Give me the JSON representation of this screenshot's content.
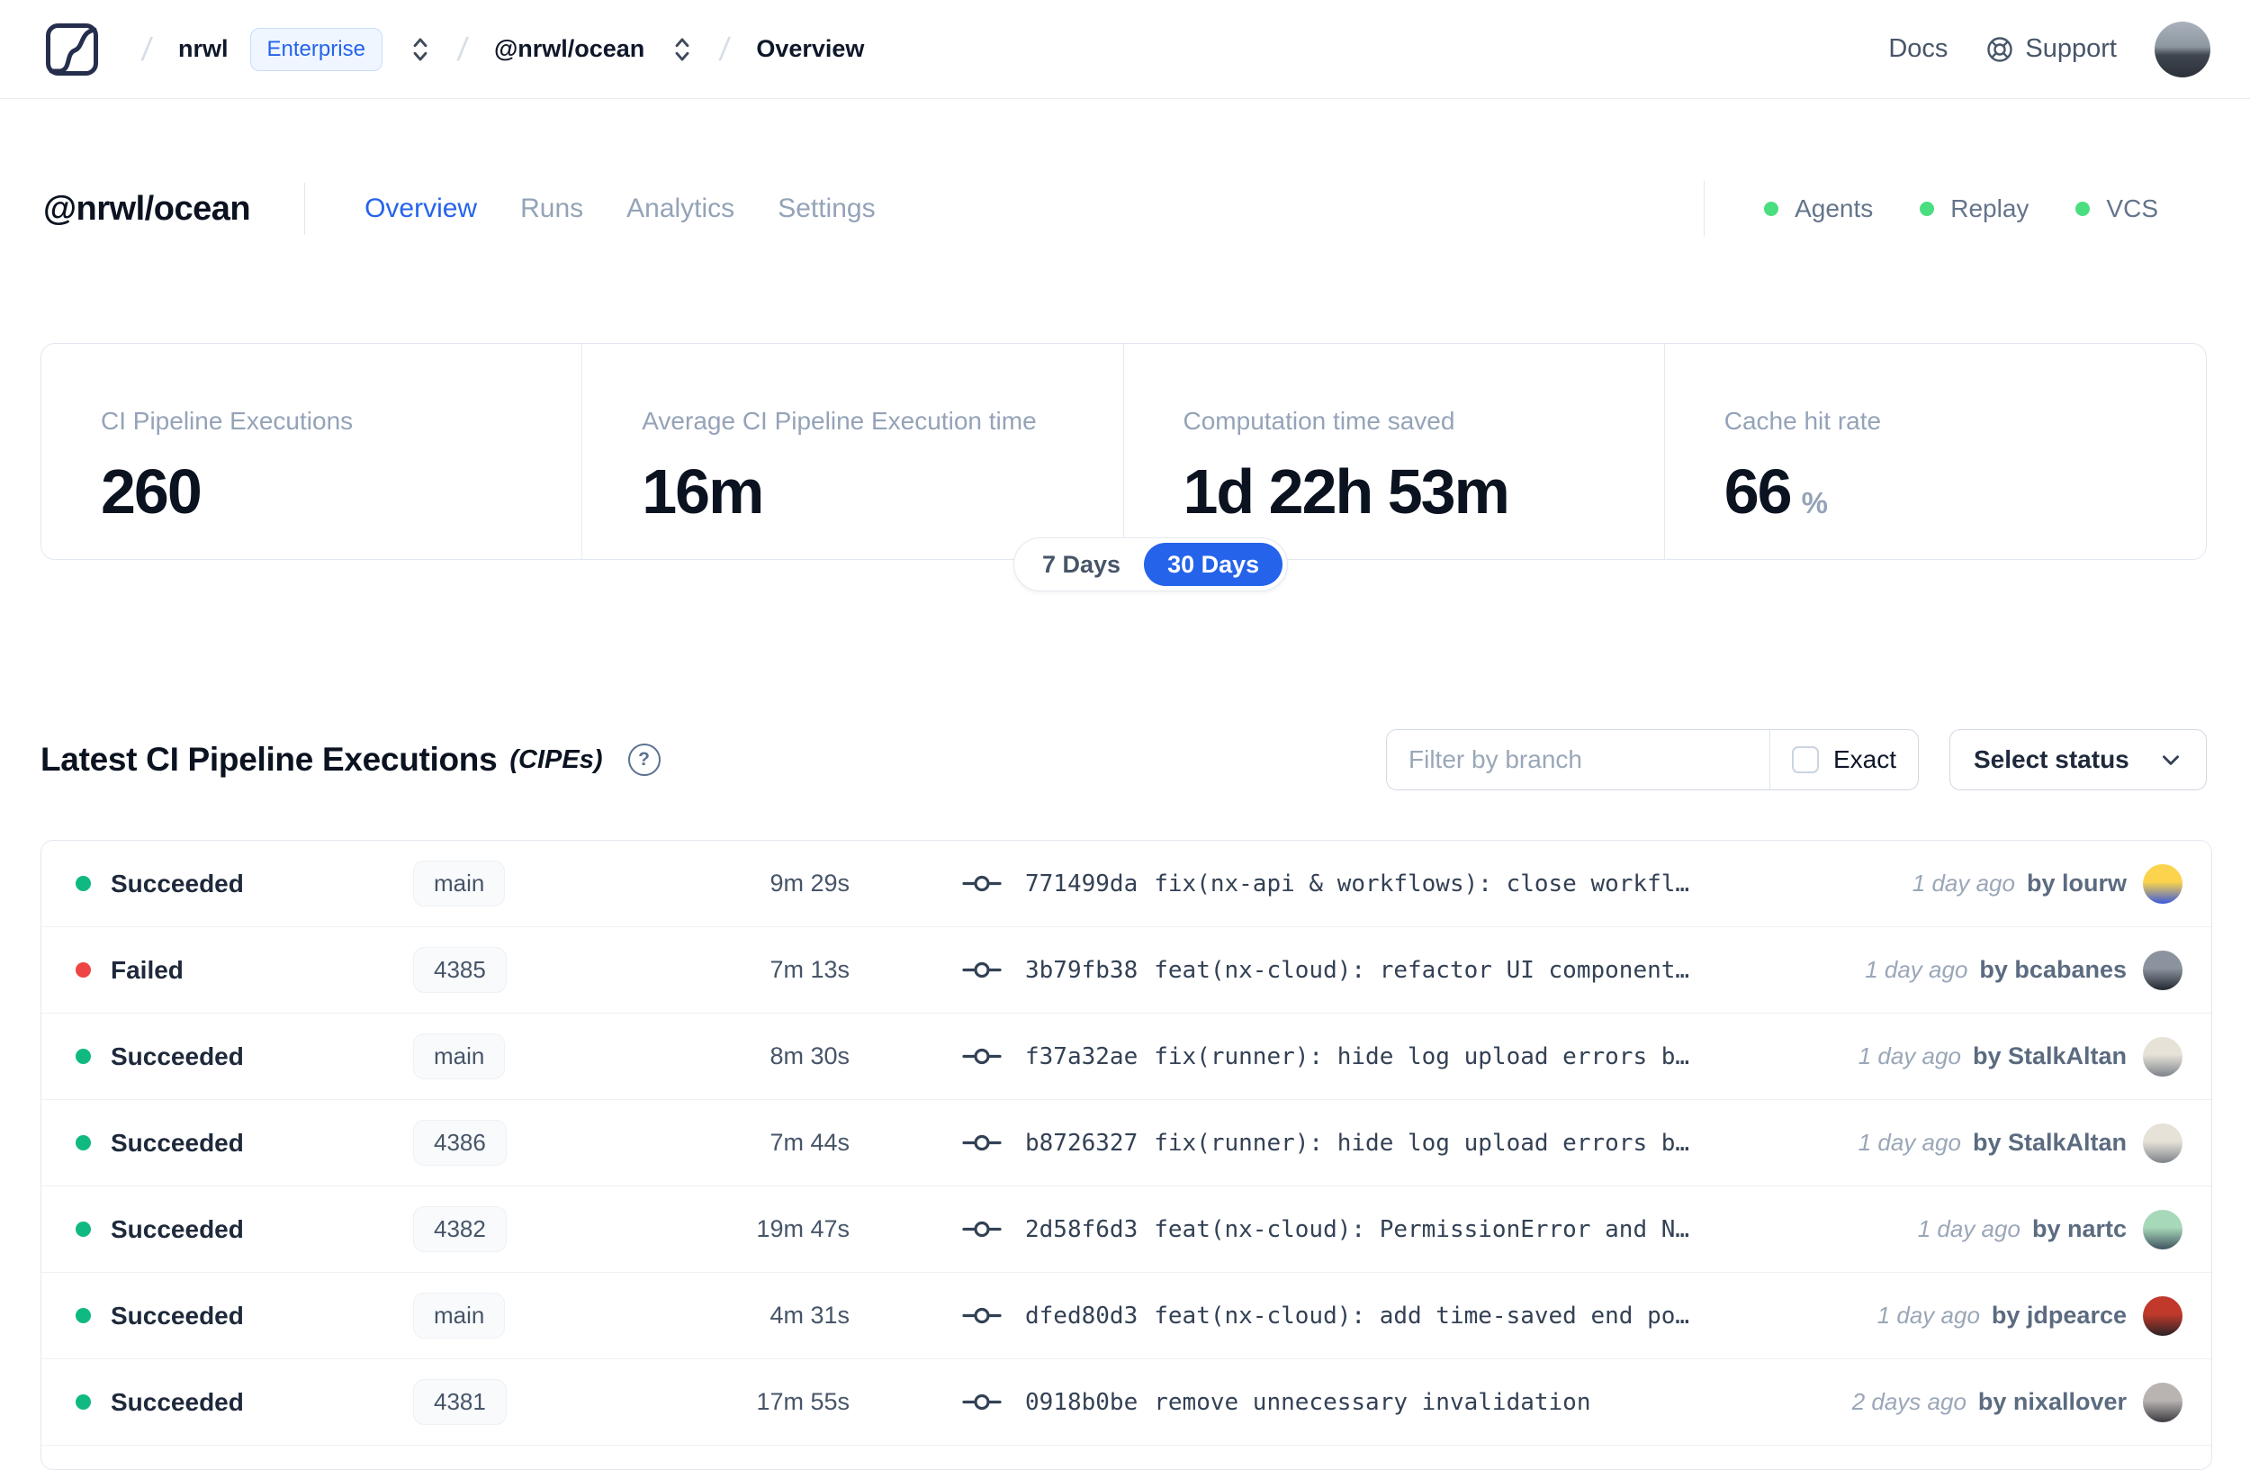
{
  "colors": {
    "accent": "#2563eb",
    "success_dot": "#10b981",
    "failed_dot": "#ef4444",
    "header_status_dot": "#4ade80"
  },
  "navbar": {
    "logo": "nx-logo",
    "breadcrumb": {
      "org": "nrwl",
      "org_badge": "Enterprise",
      "workspace": "@nrwl/ocean",
      "page": "Overview"
    },
    "links": {
      "docs": "Docs",
      "support": "Support"
    }
  },
  "header": {
    "title": "@nrwl/ocean",
    "tabs": [
      {
        "label": "Overview",
        "active": true
      },
      {
        "label": "Runs",
        "active": false
      },
      {
        "label": "Analytics",
        "active": false
      },
      {
        "label": "Settings",
        "active": false
      }
    ],
    "statuses": [
      {
        "label": "Agents"
      },
      {
        "label": "Replay"
      },
      {
        "label": "VCS"
      }
    ]
  },
  "stats": {
    "cards": [
      {
        "label": "CI Pipeline Executions",
        "value": "260",
        "unit": ""
      },
      {
        "label": "Average CI Pipeline Execution time",
        "value": "16m",
        "unit": ""
      },
      {
        "label": "Computation time saved",
        "value": "1d 22h 53m",
        "unit": ""
      },
      {
        "label": "Cache hit rate",
        "value": "66",
        "unit": "%"
      }
    ],
    "range_toggle": {
      "options": [
        "7 Days",
        "30 Days"
      ],
      "selected": "30 Days"
    }
  },
  "cipes": {
    "title": "Latest CI Pipeline Executions",
    "title_suffix": "(CIPEs)",
    "filter_placeholder": "Filter by branch",
    "filter_value": "",
    "exact_label": "Exact",
    "exact_checked": false,
    "status_select_label": "Select status",
    "rows": [
      {
        "status": "Succeeded",
        "branch": "main",
        "duration": "9m 29s",
        "commit": "771499da",
        "message": "fix(nx-api & workflows): close workfl…",
        "time": "1 day ago",
        "author": "by lourw",
        "avatar_colors": [
          "#fcd34d",
          "#3b5bdb"
        ]
      },
      {
        "status": "Failed",
        "branch": "4385",
        "duration": "7m 13s",
        "commit": "3b79fb38",
        "message": "feat(nx-cloud): refactor UI component…",
        "time": "1 day ago",
        "author": "by bcabanes",
        "avatar_colors": [
          "#8a939e",
          "#23282f"
        ]
      },
      {
        "status": "Succeeded",
        "branch": "main",
        "duration": "8m 30s",
        "commit": "f37a32ae",
        "message": "fix(runner): hide log upload errors b…",
        "time": "1 day ago",
        "author": "by StalkAltan",
        "avatar_colors": [
          "#e7e2d8",
          "#7d828a"
        ]
      },
      {
        "status": "Succeeded",
        "branch": "4386",
        "duration": "7m 44s",
        "commit": "b8726327",
        "message": "fix(runner): hide log upload errors b…",
        "time": "1 day ago",
        "author": "by StalkAltan",
        "avatar_colors": [
          "#e7e2d8",
          "#7d828a"
        ]
      },
      {
        "status": "Succeeded",
        "branch": "4382",
        "duration": "19m 47s",
        "commit": "2d58f6d3",
        "message": "feat(nx-cloud): PermissionError and N…",
        "time": "1 day ago",
        "author": "by nartc",
        "avatar_colors": [
          "#a7d8b9",
          "#40525f"
        ]
      },
      {
        "status": "Succeeded",
        "branch": "main",
        "duration": "4m 31s",
        "commit": "dfed80d3",
        "message": "feat(nx-cloud): add time-saved end po…",
        "time": "1 day ago",
        "author": "by jdpearce",
        "avatar_colors": [
          "#c0392b",
          "#2b2326"
        ]
      },
      {
        "status": "Succeeded",
        "branch": "4381",
        "duration": "17m 55s",
        "commit": "0918b0be",
        "message": "remove unnecessary invalidation",
        "time": "2 days ago",
        "author": "by nixallover",
        "avatar_colors": [
          "#b9b4b2",
          "#3c3a40"
        ]
      }
    ]
  }
}
